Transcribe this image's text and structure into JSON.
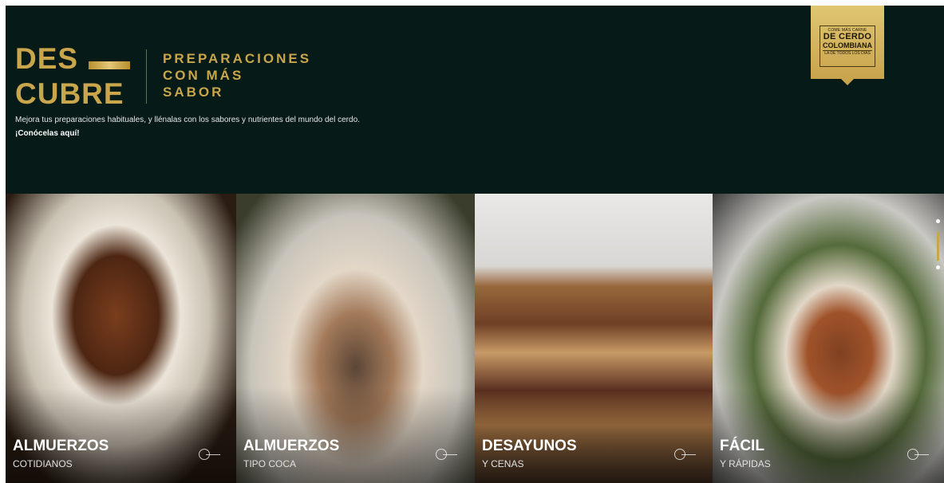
{
  "hero": {
    "brand_line1": "DES",
    "brand_line2": "CUBRE",
    "tagline": [
      "PREPARACIONES",
      "CON MÁS",
      "SABOR"
    ],
    "description": "Mejora tus preparaciones habituales, y llénalas con los sabores y nutrientes del mundo del cerdo.",
    "cta": "¡Conócelas aquí!",
    "accent_color": "#c9a64b",
    "background_color": "#061a17"
  },
  "badge": {
    "line1": "COME MÁS CARNE",
    "line2": "DE CERDO",
    "line3": "COLOMBIANA",
    "line4": "LA DE TODOS LOS DÍAS"
  },
  "cards": [
    {
      "title": "ALMUERZOS",
      "subtitle": "COTIDIANOS",
      "image": "roasted-pork-shank-with-vegetables"
    },
    {
      "title": "ALMUERZOS",
      "subtitle": "TIPO COCA",
      "image": "pulled-pork-rice-bowl"
    },
    {
      "title": "DESAYUNOS",
      "subtitle": "Y CENAS",
      "image": "pork-sandwich"
    },
    {
      "title": "FÁCIL",
      "subtitle": "Y RÁPIDAS",
      "image": "pork-belly-quinoa-salad"
    }
  ],
  "pager": {
    "count": 3,
    "active": 2
  }
}
